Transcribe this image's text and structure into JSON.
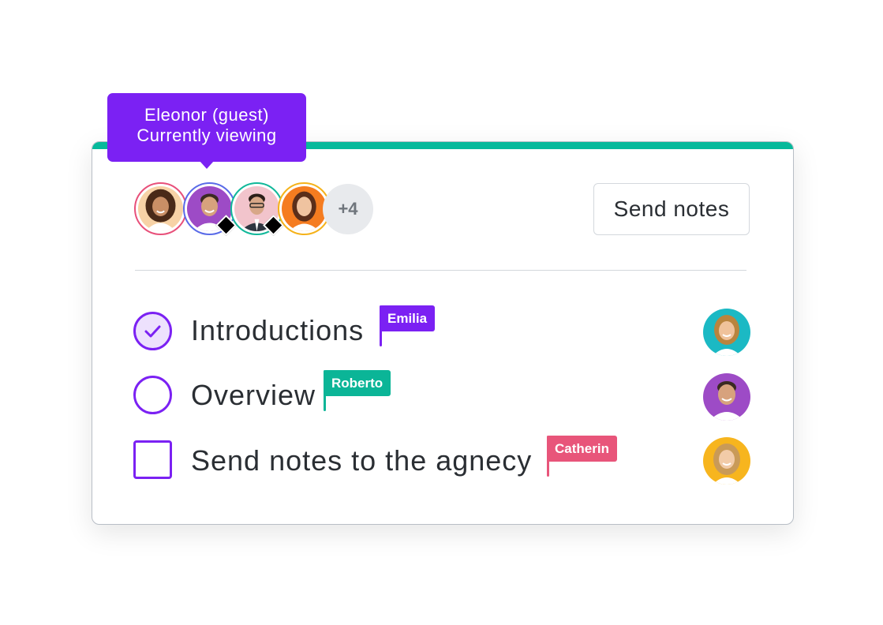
{
  "tooltip": {
    "line1": "Eleonor (guest)",
    "line2": "Currently viewing"
  },
  "participants": {
    "avatars": [
      {
        "name": "avatar-woman-curly",
        "ring": "#e8507a",
        "bg": "#f7d2a6",
        "hair": "#4a2a18",
        "skin": "#c98f66",
        "shirt": "#ffffff"
      },
      {
        "name": "avatar-man-purple",
        "ring": "#5a6be8",
        "bg": "#9d4bc6",
        "hair": "#3a2a22",
        "skin": "#d7a27d",
        "shirt": "#ffffff"
      },
      {
        "name": "avatar-man-suit",
        "ring": "#11b89a",
        "bg": "#f2c4cc",
        "hair": "#2b1e18",
        "skin": "#d8a788",
        "shirt": "#2f3540"
      },
      {
        "name": "avatar-woman-orange",
        "ring": "#f5b21a",
        "bg": "#f57c20",
        "hair": "#5a2e1a",
        "skin": "#efc3a0",
        "shirt": "#ffffff"
      }
    ],
    "more_count": "+4"
  },
  "toolbar": {
    "send_notes_label": "Send notes"
  },
  "tasks": [
    {
      "label": "Introductions",
      "state": "checked",
      "assignee": "Emilia",
      "flag_color": "#7b21f3"
    },
    {
      "label": "Overview",
      "state": "open",
      "assignee": "Roberto",
      "flag_color": "#0bb597"
    },
    {
      "label": "Send notes to the agnecy",
      "state": "square",
      "assignee": "Catherin",
      "flag_color": "#e8557a"
    }
  ],
  "colors": {
    "accent_purple": "#7b21f3",
    "accent_teal": "#06b99b",
    "accent_pink": "#e8557a"
  }
}
